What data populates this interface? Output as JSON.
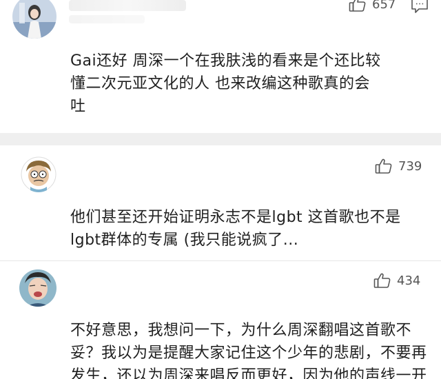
{
  "comments": [
    {
      "likes": "657",
      "text_lines": [
        "Gai还好 周深一个在我肤浅的看来是个还比较",
        "懂二次元亚文化的人 也来改编这种歌真的会",
        "吐"
      ]
    },
    {
      "likes": "739",
      "text_lines": [
        "他们甚至还开始证明永志不是lgbt 这首歌也不是",
        "lgbt群体的专属 (我只能说疯了..."
      ]
    },
    {
      "likes": "434",
      "text_lines": [
        "不好意思，我想问一下，为什么周深翻唱这首歌不",
        "妥？我以为是提醒大家记住这个少年的悲剧，不要再",
        "发生，还以为周深来唱反而更好，因为他的声线一开"
      ]
    }
  ],
  "icons": {
    "like": "thumbs-up-icon",
    "reply": "comment-icon"
  },
  "colors": {
    "divider": "#efefef",
    "icon": "#555555"
  }
}
